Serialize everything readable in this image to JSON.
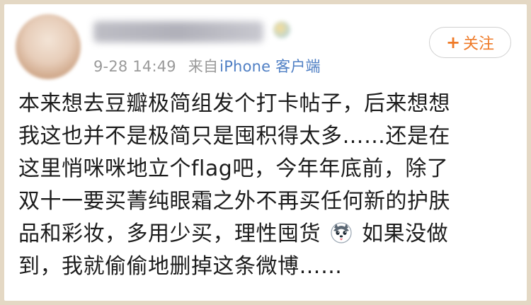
{
  "header": {
    "timestamp": "9-28 14:49",
    "source_prefix": "来自",
    "source_device": "iPhone 客户端"
  },
  "follow_button": {
    "icon": "plus-icon",
    "label": "关注",
    "color": "#ef7a27"
  },
  "post": {
    "lines": [
      "本来想去豆瓣极简组发个打卡帖子，后来想想",
      "我这也并不是极简只是囤积得太多……还是在",
      "这里悄咪咪地立个flag吧，今年年底前，除了",
      "双十一要买菁纯眼霜之外不再买任何新的护肤",
      "品和彩妆，多用少买，理性囤货",
      "如果没做",
      "到，我就偷偷地删掉这条微博……"
    ],
    "emoji_icon": "husky-face-icon"
  },
  "colors": {
    "frame": "#e4d8c4",
    "text": "#1c1c1c",
    "meta": "#9a9a9a",
    "link": "#4f7fc4"
  }
}
